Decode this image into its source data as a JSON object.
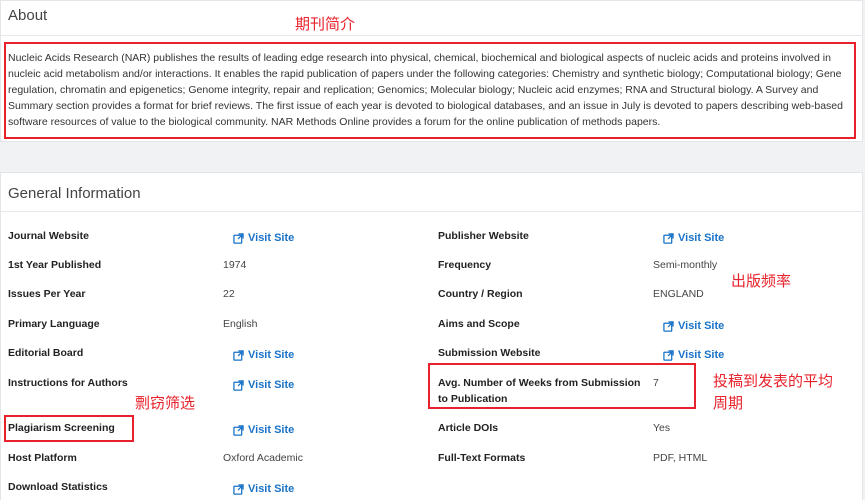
{
  "about": {
    "title": "About",
    "text": "Nucleic Acids Research (NAR) publishes the results of leading edge research into physical, chemical, biochemical and biological aspects of nucleic acids and proteins involved in nucleic acid metabolism and/or interactions. It enables the rapid publication of papers under the following categories: Chemistry and synthetic biology; Computational biology; Gene regulation, chromatin and epigenetics; Genome integrity, repair and replication; Genomics; Molecular biology; Nucleic acid enzymes; RNA and Structural biology. A Survey and Summary section provides a format for brief reviews. The first issue of each year is devoted to biological databases, and an issue in July is devoted to papers describing web-based software resources of value to the biological community. NAR Methods Online provides a forum for the online publication of methods papers."
  },
  "general": {
    "title": "General Information",
    "link_label": "Visit Site",
    "left": [
      {
        "label": "Journal Website",
        "value": "Visit Site",
        "link": true
      },
      {
        "label": "1st Year Published",
        "value": "1974",
        "link": false
      },
      {
        "label": "Issues Per Year",
        "value": "22",
        "link": false
      },
      {
        "label": "Primary Language",
        "value": "English",
        "link": false
      },
      {
        "label": "Editorial Board",
        "value": "Visit Site",
        "link": true
      },
      {
        "label": "Instructions for Authors",
        "value": "Visit Site",
        "link": true
      },
      {
        "label": "Plagiarism Screening",
        "value": "Visit Site",
        "link": true
      },
      {
        "label": "Host Platform",
        "value": "Oxford Academic",
        "link": false
      },
      {
        "label": "Download Statistics",
        "value": "Visit Site",
        "link": true
      }
    ],
    "right": [
      {
        "label": "Publisher Website",
        "value": "Visit Site",
        "link": true
      },
      {
        "label": "Frequency",
        "value": "Semi-monthly",
        "link": false
      },
      {
        "label": "Country / Region",
        "value": "ENGLAND",
        "link": false
      },
      {
        "label": "Aims and Scope",
        "value": "Visit Site",
        "link": true
      },
      {
        "label": "Submission Website",
        "value": "Visit Site",
        "link": true
      },
      {
        "label": "Avg. Number of Weeks from Submission to Publication",
        "value": "7",
        "link": false
      },
      {
        "label": "Article DOIs",
        "value": "Yes",
        "link": false
      },
      {
        "label": "Full-Text Formats",
        "value": "PDF, HTML",
        "link": false
      }
    ]
  },
  "annotations": {
    "journal_intro": "期刊简介",
    "publication_frequency": "出版频率",
    "plagiarism_screening": "剽窃筛选",
    "avg_cycle_line1": "投稿到发表的平均",
    "avg_cycle_line2": "周期",
    "color": "#e8222b"
  },
  "colors": {
    "link": "#1a73c8",
    "background": "#f1f2f4",
    "card": "#ffffff"
  }
}
